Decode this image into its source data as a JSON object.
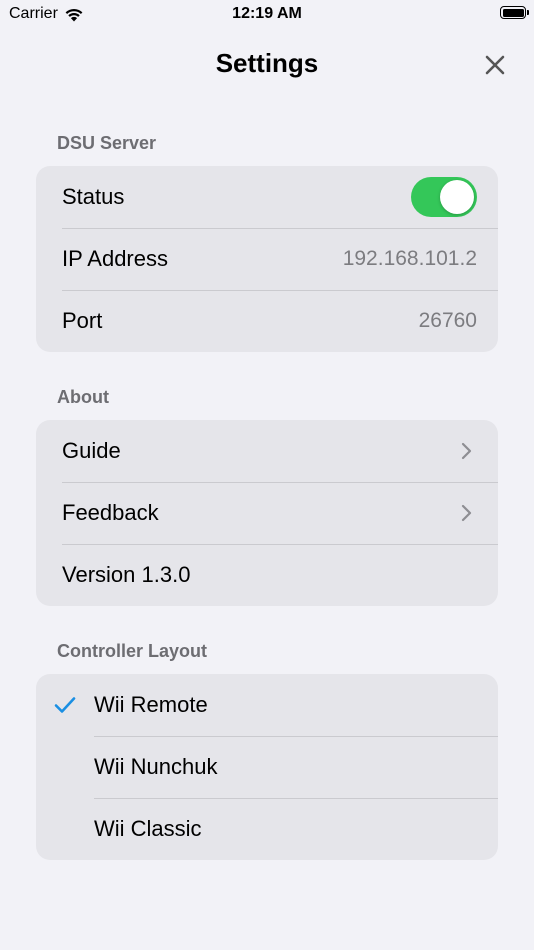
{
  "status_bar": {
    "carrier": "Carrier",
    "time": "12:19 AM"
  },
  "nav": {
    "title": "Settings",
    "close_icon": "close-icon"
  },
  "sections": {
    "dsu_server": {
      "header": "DSU Server",
      "status_label": "Status",
      "status_on": true,
      "ip_label": "IP Address",
      "ip_value": "192.168.101.2",
      "port_label": "Port",
      "port_value": "26760"
    },
    "about": {
      "header": "About",
      "guide_label": "Guide",
      "feedback_label": "Feedback",
      "version_label": "Version 1.3.0"
    },
    "controller_layout": {
      "header": "Controller Layout",
      "options": [
        "Wii Remote",
        "Wii Nunchuk",
        "Wii Classic"
      ],
      "selected": "Wii Remote"
    }
  },
  "colors": {
    "toggle_on": "#34c759",
    "check": "#1a8fe3",
    "background": "#f2f2f7",
    "group_background": "#e5e5ea"
  }
}
